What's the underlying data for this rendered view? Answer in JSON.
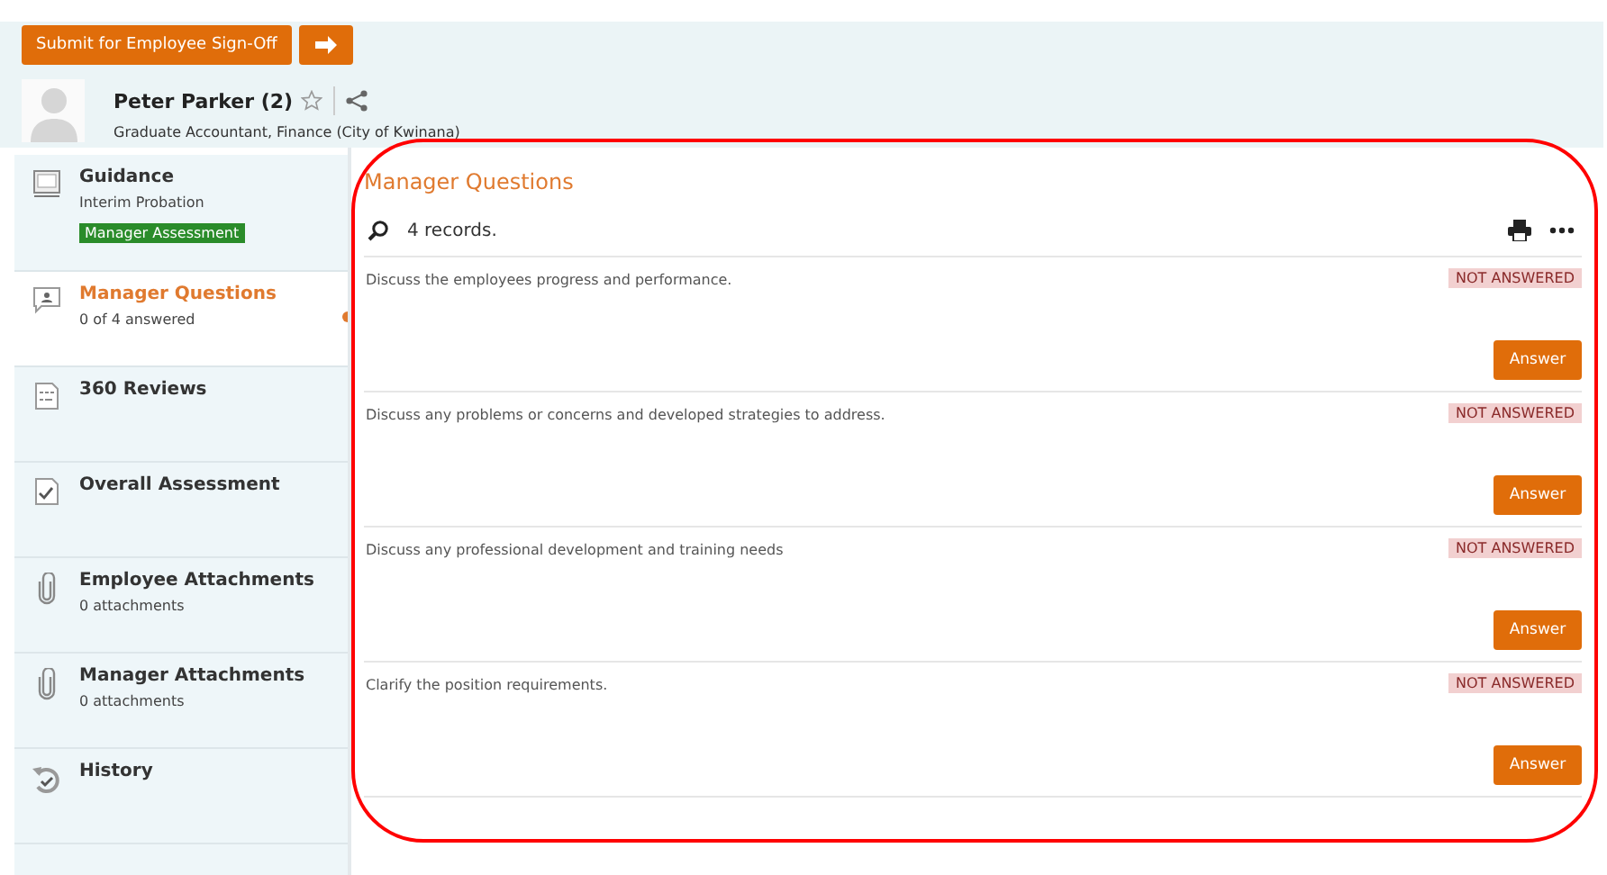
{
  "actions": {
    "submit_button": "Submit for Employee Sign-Off"
  },
  "profile": {
    "name": "Peter Parker (2)",
    "starred": false,
    "position": "Graduate Accountant, Finance (City of Kwinana)"
  },
  "sidebar": {
    "items": [
      {
        "kind": "guidance",
        "title": "Guidance",
        "subtitle": "Interim Probation",
        "badge": "Manager Assessment",
        "selected": false
      },
      {
        "kind": "questions",
        "title": "Manager Questions",
        "subtitle": "0 of 4 answered",
        "selected": true
      },
      {
        "kind": "reviews",
        "title": "360 Reviews",
        "selected": false
      },
      {
        "kind": "assessment",
        "title": "Overall Assessment",
        "selected": false
      },
      {
        "kind": "attachment",
        "title": "Employee Attachments",
        "subtitle": "0 attachments",
        "selected": false
      },
      {
        "kind": "attachment",
        "title": "Manager Attachments",
        "subtitle": "0 attachments",
        "selected": false
      },
      {
        "kind": "history",
        "title": "History",
        "selected": false
      }
    ]
  },
  "content": {
    "title": "Manager Questions",
    "record_count": "4 records.",
    "questions": [
      {
        "text": "Discuss the employees progress and performance.",
        "status": "NOT ANSWERED",
        "button": "Answer"
      },
      {
        "text": "Discuss any problems or concerns and developed strategies to address.",
        "status": "NOT ANSWERED",
        "button": "Answer"
      },
      {
        "text": "Discuss any professional development and training needs",
        "status": "NOT ANSWERED",
        "button": "Answer"
      },
      {
        "text": "Clarify the position requirements.",
        "status": "NOT ANSWERED",
        "button": "Answer"
      }
    ]
  }
}
